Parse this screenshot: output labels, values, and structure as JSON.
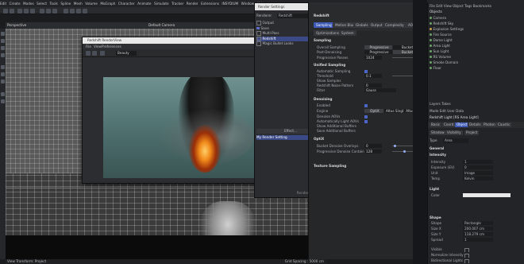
{
  "menubar": {
    "items": [
      "Edit",
      "Create",
      "Modes",
      "Select",
      "Tools",
      "Spline",
      "Mesh",
      "Volume",
      "MoGraph",
      "Character",
      "Animate",
      "Simulate",
      "Tracker",
      "Render",
      "Extensions",
      "INSYDIUM",
      "Window",
      "Help"
    ]
  },
  "viewport": {
    "header_label": "Perspective",
    "camera_label": "Default Camera",
    "menu": [
      "View",
      "Cameras",
      "Display",
      "Options",
      "Filter",
      "Panel"
    ],
    "footer_left": "View Transform: Project",
    "footer_right": "Grid Spacing : 5000 cm"
  },
  "render_view": {
    "title": "Redshift RenderView",
    "menu": [
      "File",
      "View",
      "Preferences"
    ],
    "resolution": "Beauty"
  },
  "render_settings_dialog": {
    "title": "Render Settings",
    "renderer_label": "Renderer",
    "renderer_value": "Redshift",
    "items": [
      {
        "label": "Output",
        "checked": false,
        "selected": false
      },
      {
        "label": "Save",
        "checked": true,
        "selected": false
      },
      {
        "label": "Multi-Pass",
        "checked": false,
        "selected": false
      },
      {
        "label": "Redshift",
        "checked": false,
        "selected": true
      },
      {
        "label": "Magic Bullet Looks",
        "checked": false,
        "selected": false
      }
    ],
    "effect_button": "Effect...",
    "bottom_label": "My Render Setting",
    "footer_button": "Render Setting..."
  },
  "redshift_panel": {
    "title": "Redshift",
    "tabs": [
      "Sampling",
      "Motion Blur",
      "Globals",
      "Output",
      "Complexity",
      "AOV"
    ],
    "tabs2": [
      "Optimizations",
      "System"
    ],
    "sections": {
      "sampling": "Sampling",
      "unified": "Unified Sampling",
      "denoising": "Denoising",
      "optix": "OptiX",
      "texture": "Texture Sampling"
    },
    "rows": {
      "overall_mode_label": "Overall Sampling",
      "overall_mode_value": "Progressive",
      "overall_mode_alt": "Bucket",
      "prog_label": "Post-Denoising",
      "prog_value": "Progressive",
      "prog_alt": "Bucket",
      "prog_passes_label": "Progressive Passes",
      "prog_passes_value": "1024",
      "auto_label": "Automatic Sampling",
      "threshold_label": "Threshold",
      "threshold_value": "0.1",
      "show_samples_label": "Show Samples",
      "rr_label": "Redshift Noise Pattern",
      "rr_value": "0",
      "filter_label": "Filter",
      "filter_value": "Gauss",
      "enabled_label": "Enabled",
      "engine_label": "Engine",
      "engine_value": "OptiX",
      "engine_alt": "Altus Single",
      "engine_alt2": "Altus Dual",
      "denoise_aov_label": "Denoise AOVs",
      "auto_pred_label": "Automatically Light AOVs",
      "extra_label": "Show Additional Buffers",
      "save_label": "Save Additional Buffers",
      "optix_label": "Bucket Denoise Overlays",
      "optix_value": "0",
      "prog_cont_label": "Progressive Denoise Contained",
      "prog_cont_value": "128"
    }
  },
  "right_panel": {
    "header": [
      "File",
      "Edit",
      "View",
      "Object",
      "Tags",
      "Bookmarks"
    ],
    "mode": "Objects",
    "objects": [
      {
        "name": "Camera",
        "color": "#6ba36a"
      },
      {
        "name": "Redshift Sky",
        "color": "#6ba36a"
      },
      {
        "name": "Explosion Settings",
        "color": "#c9a34a"
      },
      {
        "name": "Fire Source",
        "color": "#6ba36a"
      },
      {
        "name": "Dome Light",
        "color": "#6ba36a"
      },
      {
        "name": "Area Light",
        "color": "#6ba36a"
      },
      {
        "name": "Sun Light",
        "color": "#6ba36a"
      },
      {
        "name": "RS Volume",
        "color": "#6ba36a"
      },
      {
        "name": "Smoke Domain",
        "color": "#6ba36a"
      },
      {
        "name": "Floor",
        "color": "#6ba36a"
      }
    ],
    "tabs": [
      "Layers",
      "Takes"
    ],
    "attr_header": [
      "Mode",
      "Edit",
      "User Data"
    ],
    "attr_object": "Redshift Light [RS Area Light]",
    "attr_tabs": [
      "Basic",
      "Coord.",
      "Object",
      "Details",
      "Photon",
      "Caustic"
    ],
    "attr_tabs2": [
      "Shadow",
      "Visibility",
      "Project"
    ],
    "light_type_label": "Type",
    "light_type_value": "Area",
    "sections": [
      "General",
      "Intensity",
      "Light",
      "Shape"
    ],
    "rows": [
      {
        "label": "Intensity",
        "value": "1"
      },
      {
        "label": "Exposure (EV)",
        "value": "0"
      },
      {
        "label": "Unit",
        "value": "Image"
      },
      {
        "label": "Temp",
        "value": "Kelvin"
      },
      {
        "label": "Color",
        "value": ""
      },
      {
        "label": "Shape",
        "value": "Rectangle"
      },
      {
        "label": "Size X",
        "value": "200.007 cm"
      },
      {
        "label": "Size Y",
        "value": "118.279 cm"
      },
      {
        "label": "Spread",
        "value": "1"
      }
    ],
    "checkboxes": [
      "Visible",
      "Normalize Intensity",
      "Bidirectional Lights"
    ]
  }
}
